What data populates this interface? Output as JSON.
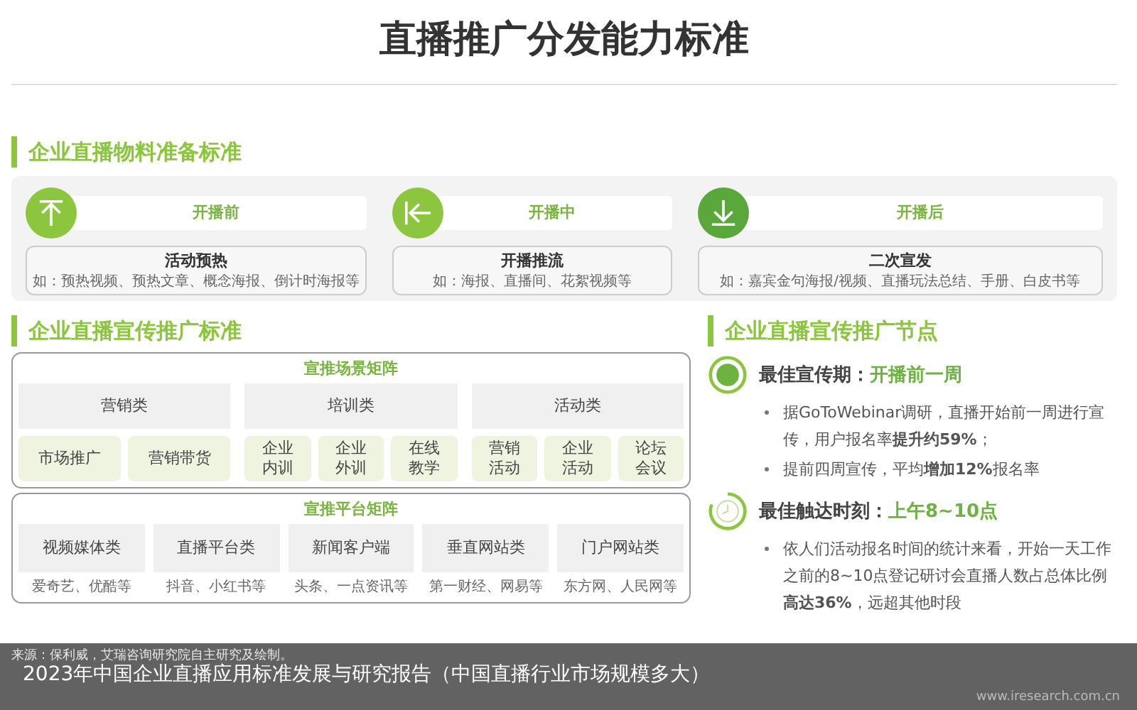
{
  "title": "直播推广分发能力标准",
  "material": {
    "heading": "企业直播物料准备标准",
    "stages": [
      {
        "kind": "up",
        "label": "开播前",
        "name": "活动预热",
        "example": "如：预热视频、预热文章、概念海报、倒计时海报等"
      },
      {
        "kind": "left",
        "label": "开播中",
        "name": "开播推流",
        "example": "如：海报、直播间、花絮视频等"
      },
      {
        "kind": "down",
        "label": "开播后",
        "name": "二次宣发",
        "example": "如：嘉宾金句海报/视频、直播玩法总结、手册、白皮书等"
      }
    ]
  },
  "promotion": {
    "heading": "企业直播宣传推广标准",
    "scenes": {
      "title": "宣推场景矩阵",
      "groups": [
        {
          "name": "营销类",
          "items": [
            "市场推广",
            "营销带货"
          ]
        },
        {
          "name": "培训类",
          "items": [
            "企业内训",
            "企业外训",
            "在线教学"
          ]
        },
        {
          "name": "活动类",
          "items": [
            "营销活动",
            "企业活动",
            "论坛会议"
          ]
        }
      ]
    },
    "platforms": {
      "title": "宣推平台矩阵",
      "items": [
        {
          "name": "视频媒体类",
          "examples": "爱奇艺、优酷等"
        },
        {
          "name": "直播平台类",
          "examples": "抖音、小红书等"
        },
        {
          "name": "新闻客户端",
          "examples": "头条、一点资讯等"
        },
        {
          "name": "垂直网站类",
          "examples": "第一财经、网易等"
        },
        {
          "name": "门户网站类",
          "examples": "东方网、人民网等"
        }
      ]
    }
  },
  "nodes": {
    "heading": "企业直播宣传推广节点",
    "points": [
      {
        "kind": "target",
        "label": "最佳宣传期：",
        "value": "开播前一周",
        "bullets": [
          "据GoToWebinar调研，直播开始前一周进行宣传，用户报名率**提升约59%**；",
          "提前四周宣传，平均**增加12%**报名率"
        ]
      },
      {
        "kind": "clock",
        "label": "最佳触达时刻：",
        "value": "上午8~10点",
        "bullets": [
          "依人们活动报名时间的统计来看，开始一天工作之前的8~10点登记研讨会直播人数占总体比例**高达36%**，远超其他时段"
        ]
      }
    ]
  },
  "source": "来源：保利威，艾瑞咨询研究院自主研究及绘制。",
  "caption": "2023年中国企业直播应用标准发展与研究报告（中国直播行业市场规模多大）",
  "website": "www.iresearch.com.cn"
}
